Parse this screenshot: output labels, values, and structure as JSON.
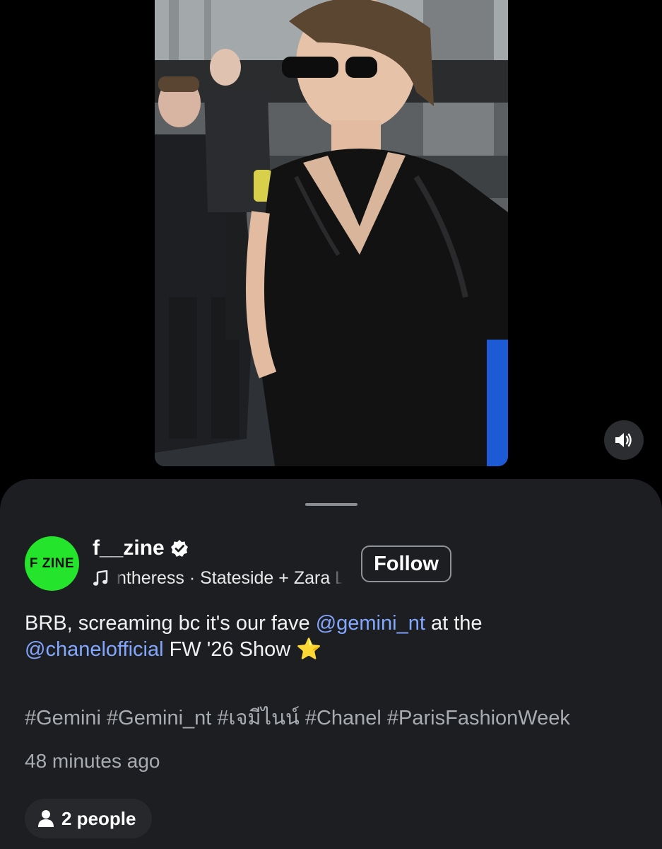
{
  "post": {
    "username": "f__zine",
    "avatar_text": "F ZINE",
    "verified": true,
    "music": "ntheress · Stateside + Zara Larsson",
    "music_icon": "music-note-icon",
    "follow_label": "Follow",
    "caption": {
      "part1": "BRB, screaming bc it's our fave ",
      "mention1": "@gemini_nt",
      "part2": " at the",
      "mention2": "@chanelofficial",
      "part3": " FW '26 Show ",
      "emoji": "⭐"
    },
    "hashtags": "#Gemini #Gemini_nt #เจมีไนน์ #Chanel #ParisFashionWeek",
    "timestamp": "48 minutes ago",
    "people": "2 people"
  },
  "controls": {
    "mute_icon": "speaker-icon"
  },
  "colors": {
    "sheet_bg": "#1c1e21",
    "avatar_bg": "#24e52b",
    "mention": "#83a6ff",
    "secondary_text": "#a8abb0"
  }
}
